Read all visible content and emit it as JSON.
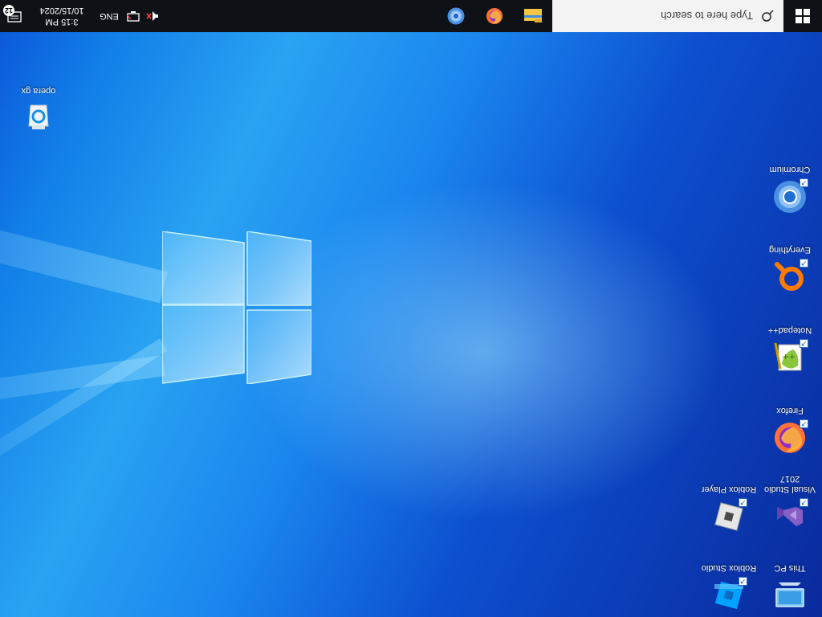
{
  "taskbar": {
    "search_placeholder": "Type here to search",
    "pinned_apps": [
      {
        "name": "File Explorer",
        "icon": "folder-icon"
      },
      {
        "name": "Firefox",
        "icon": "firefox-icon"
      },
      {
        "name": "Chromium",
        "icon": "chromium-icon"
      }
    ],
    "tray": {
      "volume_icon": "volume-muted-icon",
      "network_icon": "network-icon",
      "language": "ENG",
      "time": "3:15 PM",
      "date": "10/15/2024",
      "notification_count": "12"
    }
  },
  "desktop": {
    "icons": [
      {
        "label": "This PC",
        "icon": "this-pc-icon"
      },
      {
        "label": "Roblox Studio",
        "icon": "roblox-studio-icon"
      },
      {
        "label": "Visual Studio 2017",
        "icon": "visual-studio-icon"
      },
      {
        "label": "Roblox Player",
        "icon": "roblox-player-icon"
      },
      {
        "label": "Firefox",
        "icon": "firefox-icon"
      },
      {
        "label": "Notepad++",
        "icon": "notepad-plus-plus-icon"
      },
      {
        "label": "Everything",
        "icon": "everything-search-icon"
      },
      {
        "label": "Chromium",
        "icon": "chromium-icon"
      },
      {
        "label": "opera gx",
        "icon": "opera-gx-installer-icon"
      }
    ]
  },
  "colors": {
    "taskbar": "#0e1217",
    "search_box": "#f3f3f3",
    "wallpaper_accent": "#1a86ee",
    "firefox_orange": "#ff7139",
    "chromium_blue": "#4a90e2",
    "vs_purple": "#865fc5"
  }
}
